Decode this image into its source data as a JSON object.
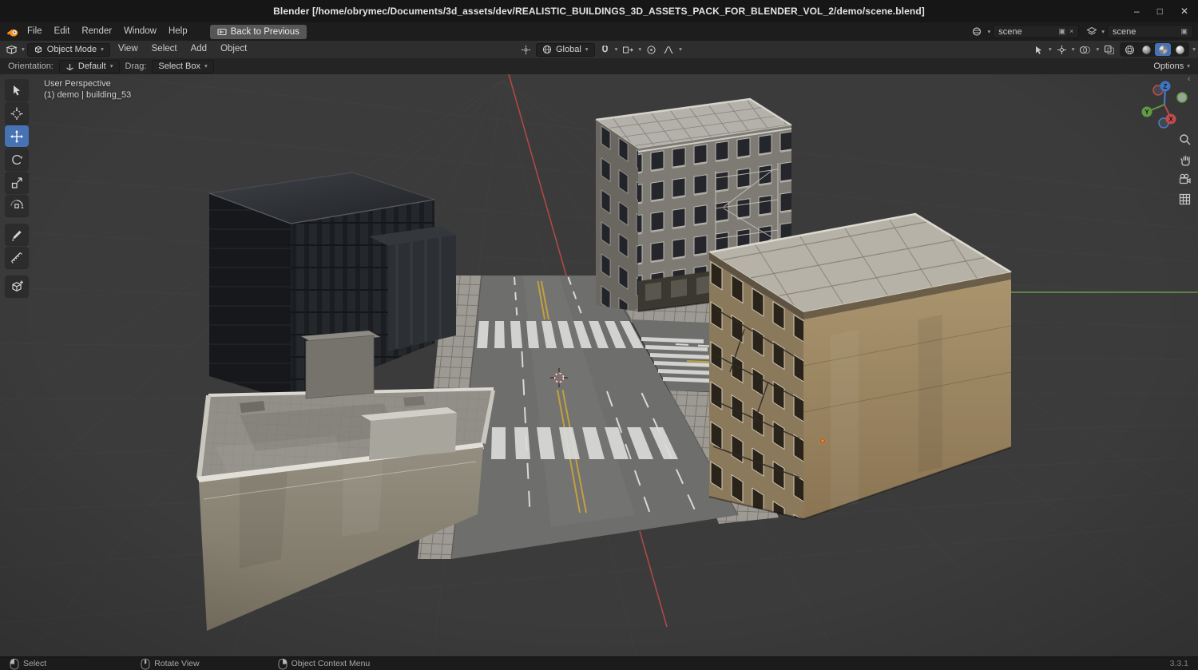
{
  "window": {
    "title": "Blender [/home/obrymec/Documents/3d_assets/dev/REALISTIC_BUILDINGS_3D_ASSETS_PACK_FOR_BLENDER_VOL_2/demo/scene.blend]",
    "controls": {
      "minimize": "–",
      "maximize": "□",
      "close": "✕"
    }
  },
  "topbar": {
    "menus": [
      "File",
      "Edit",
      "Render",
      "Window",
      "Help"
    ],
    "back_button": "Back to Previous",
    "scene_field": {
      "value": "scene",
      "copy_icon": "▣",
      "clear_icon": "×"
    },
    "view_layer_field": {
      "value": "scene",
      "copy_icon": "▣"
    }
  },
  "header": {
    "mode": "Object Mode",
    "menus": [
      "View",
      "Select",
      "Add",
      "Object"
    ],
    "transform_orientation": "Global"
  },
  "tool_settings": {
    "orientation_label": "Orientation:",
    "orientation_value": "Default",
    "drag_label": "Drag:",
    "drag_value": "Select Box",
    "options_label": "Options"
  },
  "viewport": {
    "mode_overlay": "User Perspective",
    "collection_overlay": "(1) demo | building_53",
    "axis_labels": {
      "x": "X",
      "y": "Y",
      "z": "Z"
    },
    "colors": {
      "background": "#3b3b3b",
      "axis_x": "#b34a4a",
      "axis_y": "#6da14e",
      "active_tool": "#4772b3"
    }
  },
  "statusbar": {
    "hints": [
      {
        "label": "Select"
      },
      {
        "label": "Rotate View"
      },
      {
        "label": "Object Context Menu"
      }
    ],
    "version": "3.3.1"
  },
  "icons": {
    "chevron": "▾",
    "panel_toggle": "‹"
  }
}
